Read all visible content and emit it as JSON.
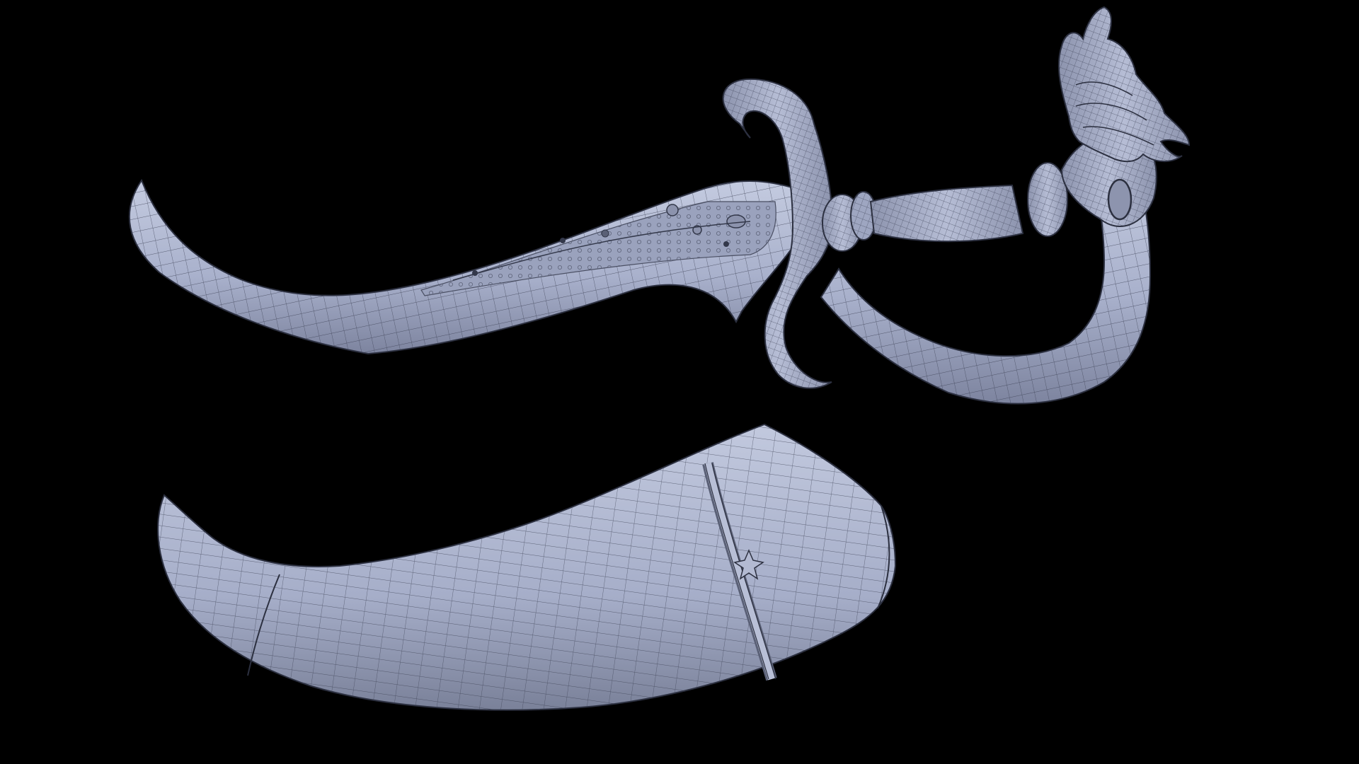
{
  "scene": {
    "background_color": "#000000",
    "surface_color": "#a9b1cc",
    "surface_shadow_color": "#6f7690",
    "surface_highlight_color": "#c9cfe2",
    "wire_color": "#3a3f52",
    "objects": [
      "dagger-wireframe-model",
      "scabbard-wireframe-model"
    ]
  }
}
